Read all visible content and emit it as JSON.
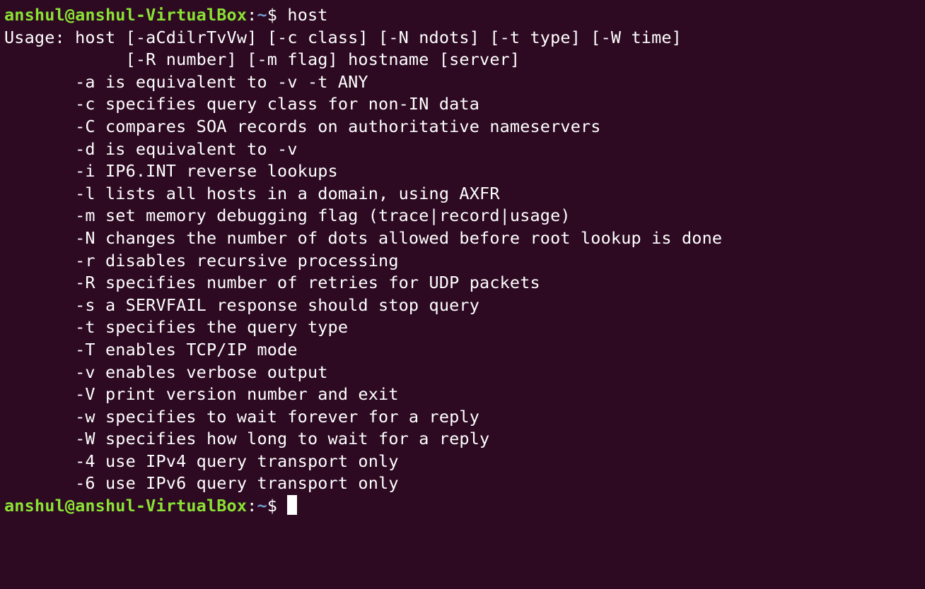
{
  "terminal": {
    "prompt_user_host": "anshul@anshul-VirtualBox",
    "prompt_colon": ":",
    "prompt_path": "~",
    "prompt_symbol": "$ ",
    "command": "host",
    "output": [
      "Usage: host [-aCdilrTvVw] [-c class] [-N ndots] [-t type] [-W time]",
      "            [-R number] [-m flag] hostname [server]",
      "       -a is equivalent to -v -t ANY",
      "       -c specifies query class for non-IN data",
      "       -C compares SOA records on authoritative nameservers",
      "       -d is equivalent to -v",
      "       -i IP6.INT reverse lookups",
      "       -l lists all hosts in a domain, using AXFR",
      "       -m set memory debugging flag (trace|record|usage)",
      "       -N changes the number of dots allowed before root lookup is done",
      "       -r disables recursive processing",
      "       -R specifies number of retries for UDP packets",
      "       -s a SERVFAIL response should stop query",
      "       -t specifies the query type",
      "       -T enables TCP/IP mode",
      "       -v enables verbose output",
      "       -V print version number and exit",
      "       -w specifies to wait forever for a reply",
      "       -W specifies how long to wait for a reply",
      "       -4 use IPv4 query transport only",
      "       -6 use IPv6 query transport only"
    ],
    "colors": {
      "background": "#2d0a22",
      "prompt_user": "#8ae234",
      "prompt_path": "#729fcf",
      "text": "#ffffff"
    }
  }
}
